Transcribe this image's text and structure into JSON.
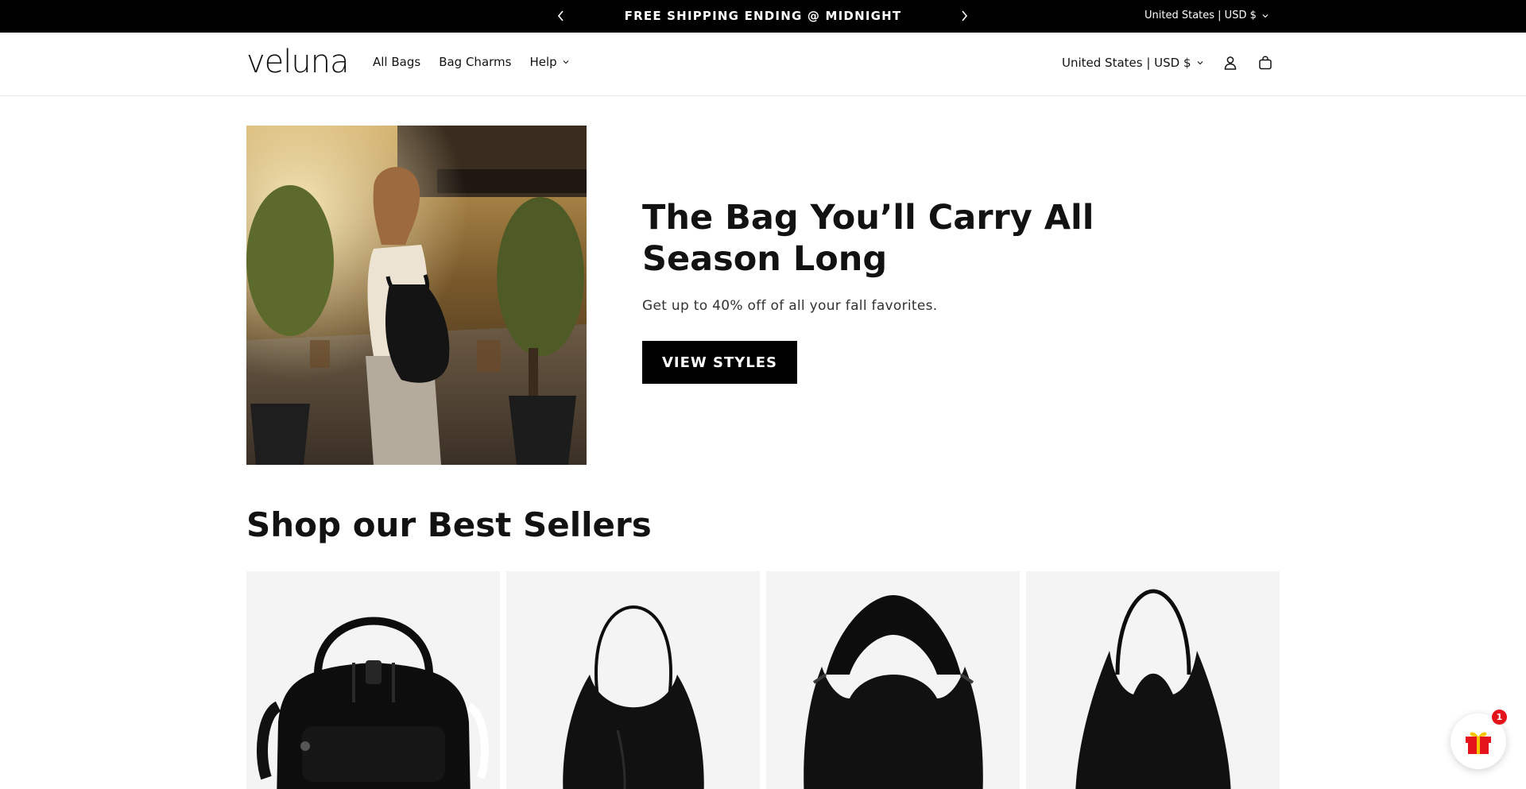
{
  "announcement": {
    "message": "FREE SHIPPING ENDING @ MIDNIGHT",
    "locale": "United States | USD $"
  },
  "header": {
    "logo": "veluna",
    "nav": [
      {
        "label": "All Bags"
      },
      {
        "label": "Bag Charms"
      },
      {
        "label": "Help"
      }
    ],
    "locale": "United States | USD $"
  },
  "hero": {
    "title": "The Bag You’ll Carry All Season Long",
    "subtitle": "Get up to 40% off of all your fall favorites.",
    "cta": "VIEW STYLES"
  },
  "best_sellers": {
    "title": "Shop our Best Sellers"
  },
  "gift_widget": {
    "badge": "1"
  },
  "colors": {
    "announcement_bg": "#000000",
    "button_bg": "#000000",
    "card_bg": "#f4f4f4",
    "gift_badge": "#e3141b"
  }
}
